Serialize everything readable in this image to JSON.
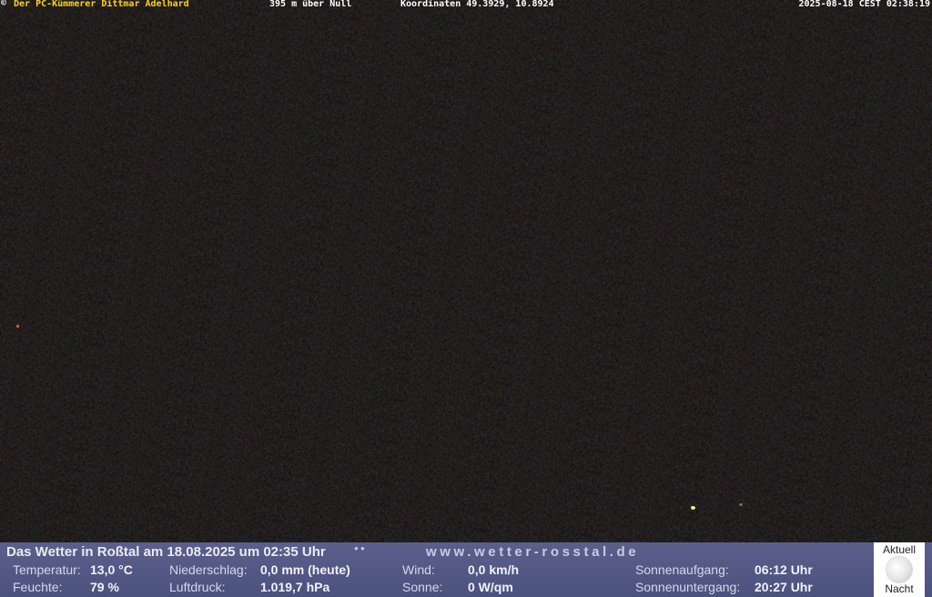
{
  "overlay": {
    "copyright_symbol": "©",
    "owner": "Der PC-Kümmerer Dittmar Adelhard",
    "altitude": "395 m über Null",
    "coordinates": "Koordinaten 49.3929, 10.8924",
    "timestamp": "2025-08-18 CEST 02:38:19"
  },
  "weather": {
    "heading": "Das Wetter in Roßtal am 18.08.2025 um 02:35 Uhr",
    "website": "www.wetter-rosstal.de",
    "temperature_label": "Temperatur:",
    "temperature_value": "13,0 °C",
    "humidity_label": "Feuchte:",
    "humidity_value": "79 %",
    "precipitation_label": "Niederschlag:",
    "precipitation_value": "0,0 mm (heute)",
    "pressure_label": "Luftdruck:",
    "pressure_value": "1.019,7 hPa",
    "wind_label": "Wind:",
    "wind_value": "0,0 km/h",
    "sun_label": "Sonne:",
    "sun_value": "0 W/qm",
    "sunrise_label": "Sonnenaufgang:",
    "sunrise_value": "06:12 Uhr",
    "sunset_label": "Sonnenuntergang:",
    "sunset_value": "20:27 Uhr"
  },
  "moon": {
    "top_label": "Aktuell",
    "bottom_label": "Nacht",
    "icon": "moon-icon"
  },
  "colors": {
    "owner_text": "#ffd21a",
    "panel_bg": "#545985",
    "sky": "#1c1918"
  }
}
